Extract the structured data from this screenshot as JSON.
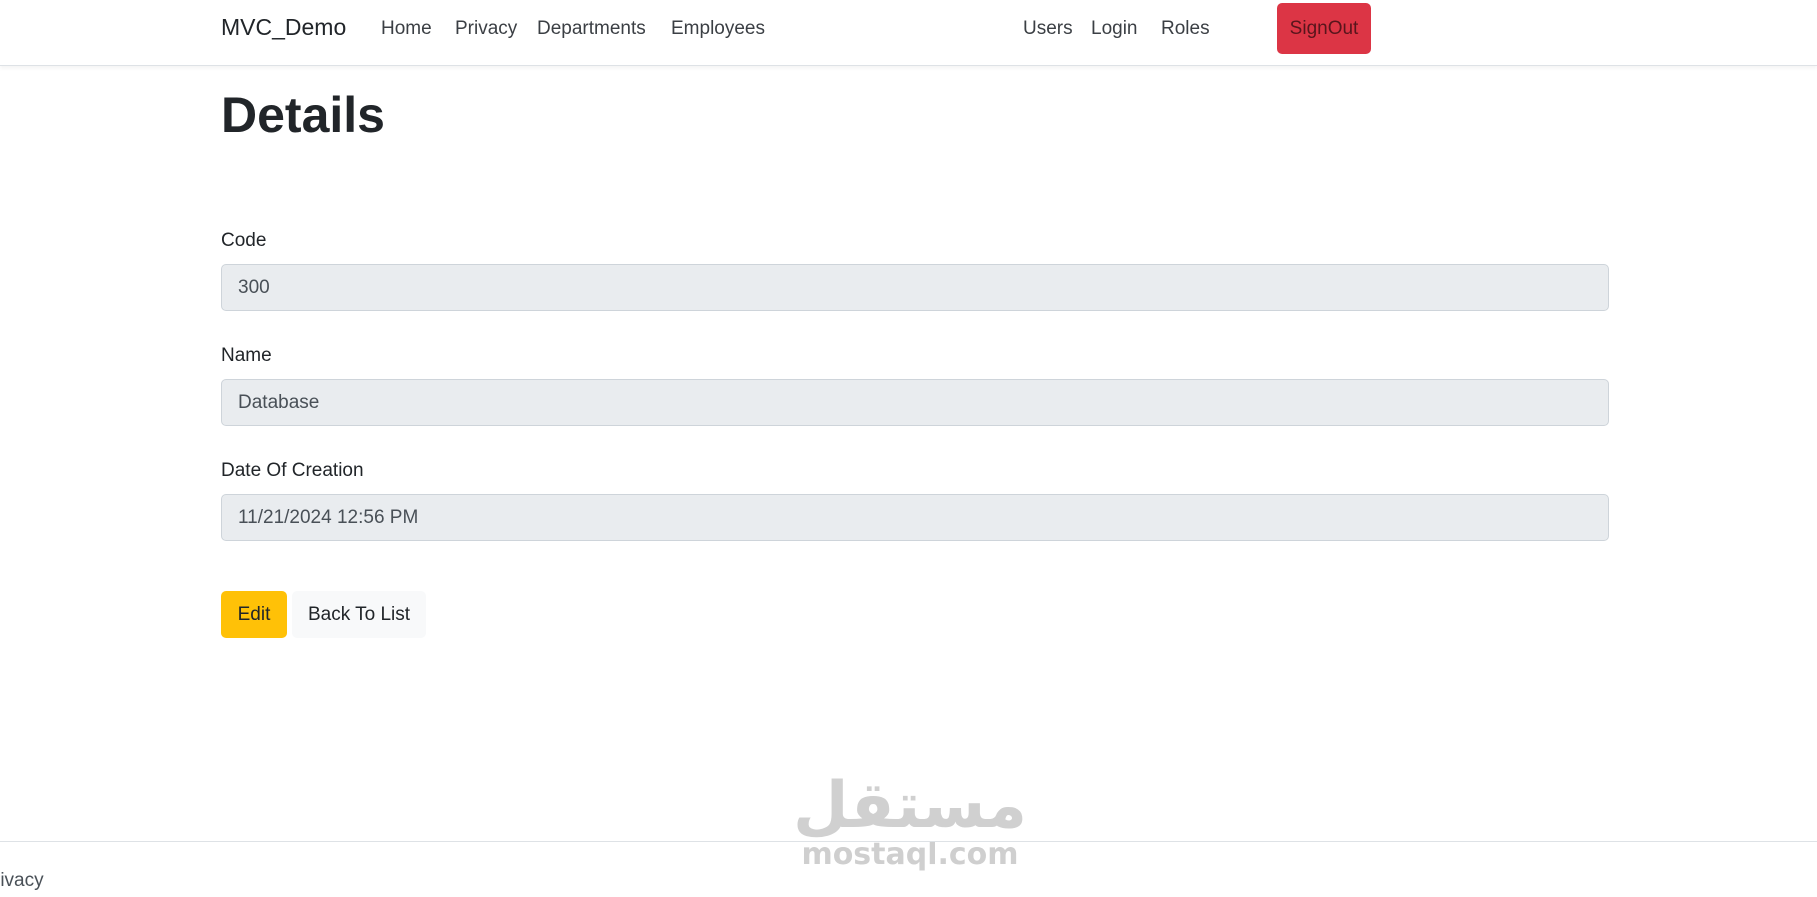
{
  "navbar": {
    "brand": "MVC_Demo",
    "left_links": [
      "Home",
      "Privacy",
      "Departments",
      "Employees"
    ],
    "right_links": [
      "Users",
      "Login",
      "Roles"
    ],
    "signout_label": "SignOut",
    "signout_color": "#dc3545"
  },
  "main": {
    "title": "Details",
    "fields": [
      {
        "label": "Code",
        "value": "300"
      },
      {
        "label": "Name",
        "value": "Database"
      },
      {
        "label": "Date Of Creation",
        "value": "11/21/2024 12:56 PM"
      }
    ],
    "edit_label": "Edit",
    "edit_color": "#ffc107",
    "back_label": "Back To List"
  },
  "footer": {
    "link": "rivacy"
  },
  "watermark": {
    "logo": "مستقل",
    "text": "mostaql.com"
  }
}
